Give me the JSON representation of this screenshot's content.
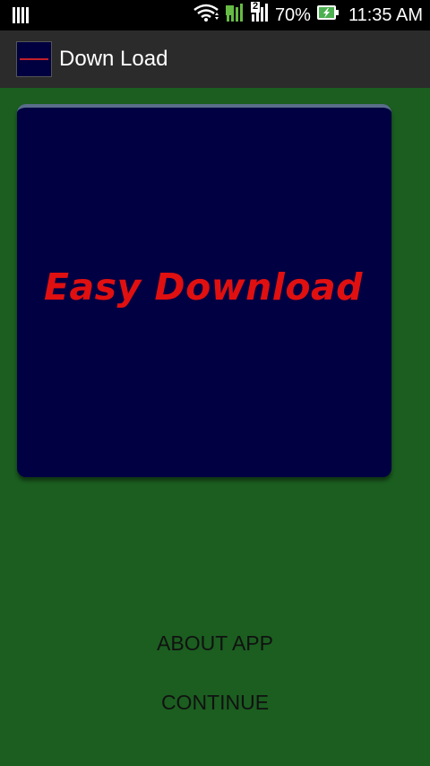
{
  "status_bar": {
    "battery_percent": "70%",
    "time": "11:35 AM",
    "sim2_label": "2",
    "icons": [
      "notification-bars-icon",
      "wifi-icon",
      "signal-sim1-icon",
      "signal-sim2-icon",
      "battery-charging-icon"
    ]
  },
  "action_bar": {
    "title": "Down Load",
    "icon_name": "app-logo-icon"
  },
  "banner": {
    "text": "Easy Download"
  },
  "buttons": {
    "about": "ABOUT APP",
    "continue": "CONTINUE"
  },
  "colors": {
    "background": "#1b5e20",
    "banner": "#000042",
    "banner_text": "#e01010",
    "action_bar": "#2b2b2b"
  }
}
